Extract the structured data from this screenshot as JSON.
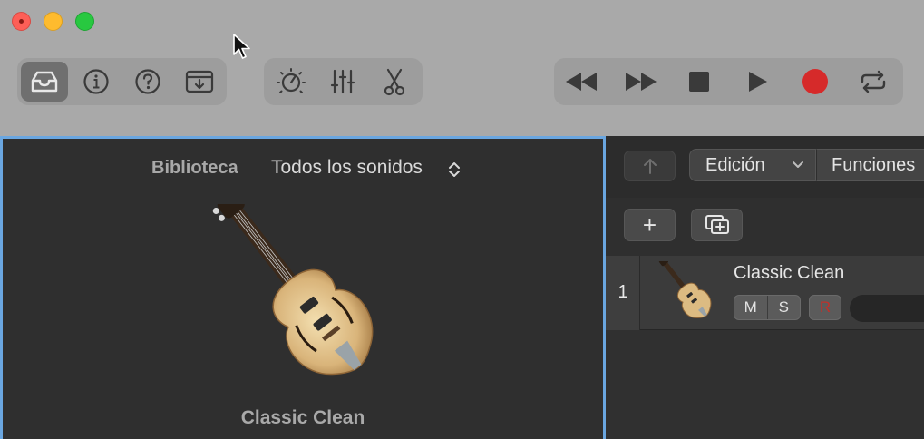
{
  "window": {
    "traffic_lights": [
      "close",
      "minimize",
      "zoom"
    ]
  },
  "toolbar": {
    "view_group": [
      "library-icon",
      "info-icon",
      "help-icon",
      "download-icon"
    ],
    "edit_group": [
      "smart-controls-icon",
      "mixer-icon",
      "scissors-icon"
    ],
    "transport_group": [
      "rewind-icon",
      "forward-icon",
      "stop-icon",
      "play-icon",
      "record-icon",
      "cycle-icon"
    ],
    "record_color": "#d62a2a"
  },
  "library": {
    "title": "Biblioteca",
    "selector": "Todos los sonidos",
    "selected_name": "Classic Clean"
  },
  "tracks": {
    "edit_menu": "Edición",
    "functions_menu": "Funciones",
    "add_label": "+",
    "rows": [
      {
        "number": "1",
        "name": "Classic Clean",
        "mute": "M",
        "solo": "S",
        "record": "R"
      }
    ]
  }
}
